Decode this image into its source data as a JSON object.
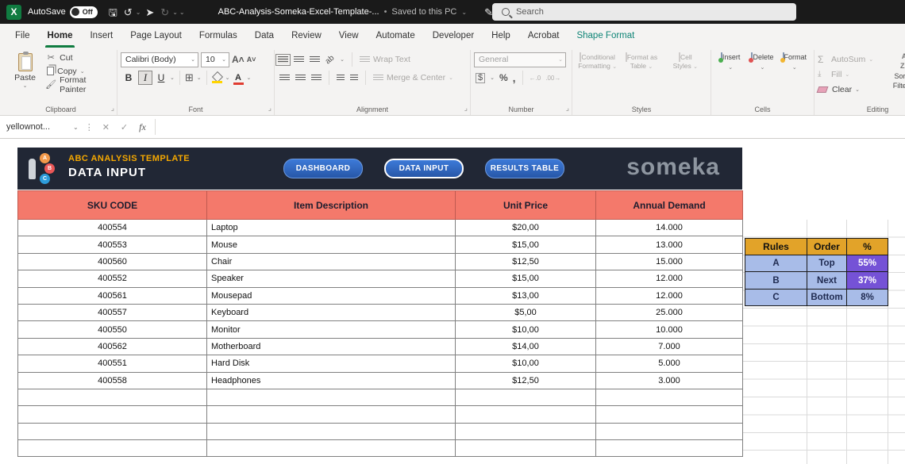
{
  "titlebar": {
    "autosave_label": "AutoSave",
    "autosave_state": "Off",
    "filename": "ABC-Analysis-Someka-Excel-Template-...",
    "saved_status": "Saved to this PC",
    "search_placeholder": "Search"
  },
  "ribbon": {
    "tabs": [
      {
        "label": "File"
      },
      {
        "label": "Home",
        "active": true
      },
      {
        "label": "Insert"
      },
      {
        "label": "Page Layout"
      },
      {
        "label": "Formulas"
      },
      {
        "label": "Data"
      },
      {
        "label": "Review"
      },
      {
        "label": "View"
      },
      {
        "label": "Automate"
      },
      {
        "label": "Developer"
      },
      {
        "label": "Help"
      },
      {
        "label": "Acrobat"
      },
      {
        "label": "Shape Format",
        "contextual": true
      }
    ],
    "clipboard": {
      "group_label": "Clipboard",
      "paste": "Paste",
      "cut": "Cut",
      "copy": "Copy",
      "format_painter": "Format Painter"
    },
    "font": {
      "group_label": "Font",
      "font_name": "Calibri (Body)",
      "font_size": "10",
      "bold": "B",
      "italic": "I",
      "underline": "U"
    },
    "alignment": {
      "group_label": "Alignment",
      "wrap_text": "Wrap Text",
      "merge_center": "Merge & Center"
    },
    "number": {
      "group_label": "Number",
      "format": "General"
    },
    "styles": {
      "group_label": "Styles",
      "conditional_line1": "Conditional",
      "conditional_line2": "Formatting",
      "format_table_line1": "Format as",
      "format_table_line2": "Table",
      "cell_styles_line1": "Cell",
      "cell_styles_line2": "Styles"
    },
    "cells": {
      "group_label": "Cells",
      "insert": "Insert",
      "delete": "Delete",
      "format": "Format"
    },
    "editing": {
      "group_label": "Editing",
      "autosum": "AutoSum",
      "fill": "Fill",
      "clear": "Clear",
      "sort_line1": "Sort &",
      "sort_line2": "Filter"
    }
  },
  "formula_bar": {
    "name_box": "yellownot...",
    "fx_label": "fx"
  },
  "sheet": {
    "banner": {
      "template_title": "ABC ANALYSIS TEMPLATE",
      "page_title": "DATA INPUT",
      "logo_letters": [
        "A",
        "B",
        "C"
      ],
      "nav_buttons": [
        {
          "label": "DASHBOARD",
          "active": false
        },
        {
          "label": "DATA INPUT",
          "active": true
        },
        {
          "label": "RESULTS TABLE",
          "active": false
        }
      ],
      "logo_text": "someka"
    },
    "data_table": {
      "headers": [
        "SKU CODE",
        "Item Description",
        "Unit Price",
        "Annual Demand"
      ],
      "rows": [
        [
          "400554",
          "Laptop",
          "$20,00",
          "14.000"
        ],
        [
          "400553",
          "Mouse",
          "$15,00",
          "13.000"
        ],
        [
          "400560",
          "Chair",
          "$12,50",
          "15.000"
        ],
        [
          "400552",
          "Speaker",
          "$15,00",
          "12.000"
        ],
        [
          "400561",
          "Mousepad",
          "$13,00",
          "12.000"
        ],
        [
          "400557",
          "Keyboard",
          "$5,00",
          "25.000"
        ],
        [
          "400550",
          "Monitor",
          "$10,00",
          "10.000"
        ],
        [
          "400562",
          "Motherboard",
          "$14,00",
          "7.000"
        ],
        [
          "400551",
          "Hard Disk",
          "$10,00",
          "5.000"
        ],
        [
          "400558",
          "Headphones",
          "$12,50",
          "3.000"
        ]
      ],
      "empty_row_count": 4
    },
    "rules_table": {
      "headers": [
        "Rules",
        "Order",
        "%"
      ],
      "rows": [
        {
          "rule": "A",
          "order": "Top",
          "percent": "55%",
          "highlight": true
        },
        {
          "rule": "B",
          "order": "Next",
          "percent": "37%",
          "highlight": true
        },
        {
          "rule": "C",
          "order": "Bottom",
          "percent": "8%",
          "highlight": false
        }
      ]
    }
  },
  "colors": {
    "header_fill": "#F4796B",
    "banner_bg": "#212735",
    "button_blue": "#2E6BC4",
    "rules_header_fill": "#E2A329",
    "rules_cell_fill": "#A8BCE8",
    "rules_percent_fill": "#7552D6",
    "tab_accent_green": "#107C41",
    "contextual_tab_teal": "#0E8476"
  }
}
